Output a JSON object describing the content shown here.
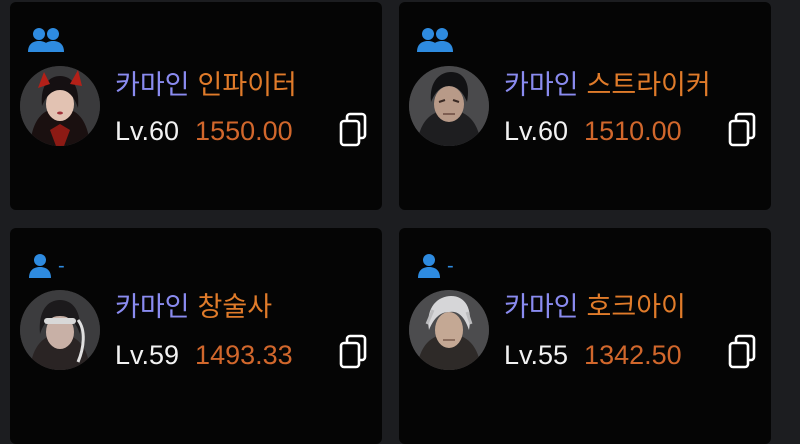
{
  "colors": {
    "background": "#1c1d20",
    "card": "#050505",
    "server": "#8a8bf0",
    "job": "#e07b2a",
    "item_level": "#d1672c",
    "level": "#f2f2f2",
    "party_icon": "#2e8be0"
  },
  "characters": [
    {
      "party_icon": "party-group-icon",
      "party_label": "",
      "server": "카마인",
      "job": "인파이터",
      "level": "Lv.60",
      "item_level": "1550.00",
      "copy_icon": "copy-icon"
    },
    {
      "party_icon": "party-group-icon",
      "party_label": "",
      "server": "카마인",
      "job": "스트라이커",
      "level": "Lv.60",
      "item_level": "1510.00",
      "copy_icon": "copy-icon"
    },
    {
      "party_icon": "solo-user-icon",
      "party_label": "-",
      "server": "카마인",
      "job": "창술사",
      "level": "Lv.59",
      "item_level": "1493.33",
      "copy_icon": "copy-icon"
    },
    {
      "party_icon": "solo-user-icon",
      "party_label": "-",
      "server": "카마인",
      "job": "호크아이",
      "level": "Lv.55",
      "item_level": "1342.50",
      "copy_icon": "copy-icon"
    }
  ]
}
